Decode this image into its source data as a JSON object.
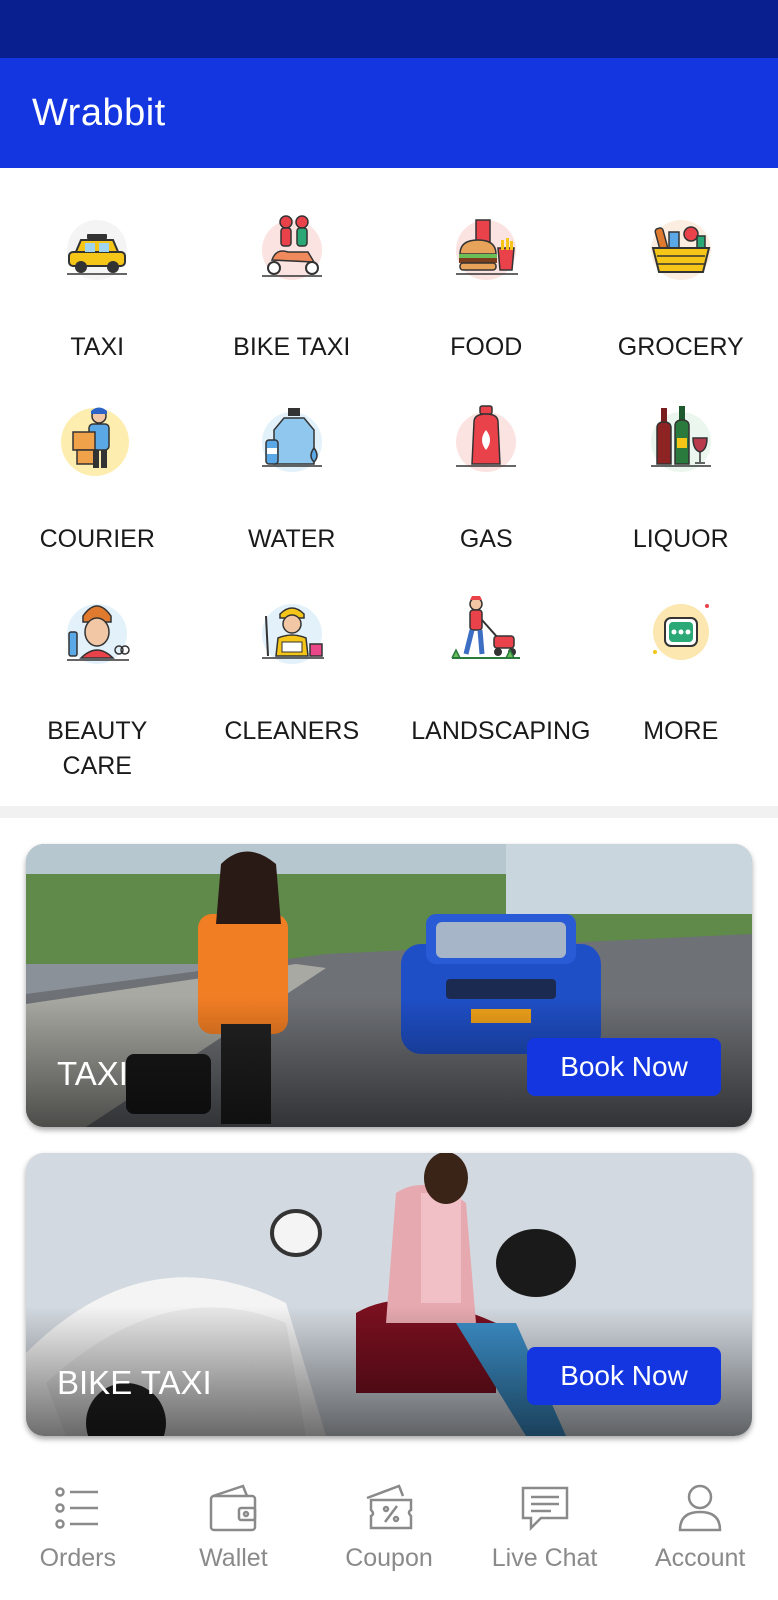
{
  "app": {
    "title": "Wrabbit"
  },
  "categories": [
    {
      "label": "TAXI",
      "icon": "taxi-icon"
    },
    {
      "label": "BIKE TAXI",
      "icon": "scooter-riders-icon"
    },
    {
      "label": "FOOD",
      "icon": "burger-fries-icon"
    },
    {
      "label": "GROCERY",
      "icon": "grocery-basket-icon"
    },
    {
      "label": "COURIER",
      "icon": "courier-delivery-icon"
    },
    {
      "label": "WATER",
      "icon": "water-bottle-icon"
    },
    {
      "label": "GAS",
      "icon": "gas-cylinder-icon"
    },
    {
      "label": "LIQUOR",
      "icon": "wine-bottles-icon"
    },
    {
      "label": "BEAUTY CARE",
      "icon": "beauty-care-icon"
    },
    {
      "label": "CLEANERS",
      "icon": "cleaner-icon"
    },
    {
      "label": "LANDSCAPING",
      "icon": "lawn-mower-icon"
    },
    {
      "label": "MORE",
      "icon": "more-dots-icon"
    }
  ],
  "banners": [
    {
      "title": "TAXI",
      "button": "Book Now"
    },
    {
      "title": "BIKE TAXI",
      "button": "Book Now"
    }
  ],
  "bottom_nav": [
    {
      "label": "Orders",
      "icon": "list-icon"
    },
    {
      "label": "Wallet",
      "icon": "wallet-icon"
    },
    {
      "label": "Coupon",
      "icon": "coupon-icon"
    },
    {
      "label": "Live Chat",
      "icon": "chat-icon"
    },
    {
      "label": "Account",
      "icon": "user-icon"
    }
  ],
  "colors": {
    "status_bar": "#0a1f8f",
    "primary": "#1336e0",
    "nav_gray": "#8a8a8a"
  }
}
